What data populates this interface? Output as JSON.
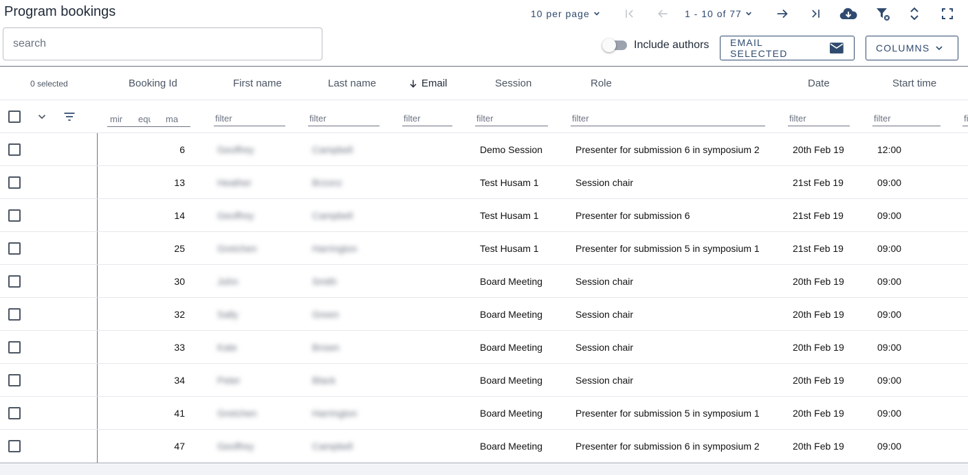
{
  "title": "Program bookings",
  "pager": {
    "per_page": "10 per page",
    "range": "1 - 10 of 77"
  },
  "search": {
    "placeholder": "search"
  },
  "toggle": {
    "label": "Include authors",
    "on": false
  },
  "buttons": {
    "email_selected": "EMAIL SELECTED",
    "columns": "COLUMNS"
  },
  "columns": {
    "selected": "0 selected",
    "booking_id": "Booking Id",
    "first_name": "First name",
    "last_name": "Last name",
    "email": "Email",
    "session": "Session",
    "role": "Role",
    "date": "Date",
    "start_time": "Start time"
  },
  "filters": {
    "min": "mir",
    "equ": "equ",
    "max": "ma",
    "filter": "filter"
  },
  "rows": [
    {
      "id": "6",
      "first": "Geoffrey",
      "last": "Campbell",
      "session": "Demo Session",
      "role": "Presenter for submission 6 in symposium 2",
      "date": "20th Feb 19",
      "time": "12:00"
    },
    {
      "id": "13",
      "first": "Heather",
      "last": "Brzonz",
      "session": "Test Husam 1",
      "role": "Session chair",
      "date": "21st Feb 19",
      "time": "09:00"
    },
    {
      "id": "14",
      "first": "Geoffrey",
      "last": "Campbell",
      "session": "Test Husam 1",
      "role": "Presenter for submission 6",
      "date": "21st Feb 19",
      "time": "09:00"
    },
    {
      "id": "25",
      "first": "Gretchen",
      "last": "Harrington",
      "session": "Test Husam 1",
      "role": "Presenter for submission 5 in symposium 1",
      "date": "21st Feb 19",
      "time": "09:00"
    },
    {
      "id": "30",
      "first": "John",
      "last": "Smith",
      "session": "Board Meeting",
      "role": "Session chair",
      "date": "20th Feb 19",
      "time": "09:00"
    },
    {
      "id": "32",
      "first": "Sally",
      "last": "Green",
      "session": "Board Meeting",
      "role": "Session chair",
      "date": "20th Feb 19",
      "time": "09:00"
    },
    {
      "id": "33",
      "first": "Kate",
      "last": "Brown",
      "session": "Board Meeting",
      "role": "Session chair",
      "date": "20th Feb 19",
      "time": "09:00"
    },
    {
      "id": "34",
      "first": "Peter",
      "last": "Black",
      "session": "Board Meeting",
      "role": "Session chair",
      "date": "20th Feb 19",
      "time": "09:00"
    },
    {
      "id": "41",
      "first": "Gretchen",
      "last": "Harrington",
      "session": "Board Meeting",
      "role": "Presenter for submission 5 in symposium 1",
      "date": "20th Feb 19",
      "time": "09:00"
    },
    {
      "id": "47",
      "first": "Geoffrey",
      "last": "Campbell",
      "session": "Board Meeting",
      "role": "Presenter for submission 6 in symposium 2",
      "date": "20th Feb 19",
      "time": "09:00"
    }
  ],
  "colors": {
    "accent": "#2f4a6e",
    "divider": "#e5e7eb"
  },
  "icons": [
    "chevron-down-icon",
    "first-page-icon",
    "arrow-left-icon",
    "arrow-right-icon",
    "last-page-icon",
    "cloud-download-icon",
    "filter-clear-icon",
    "expand-collapse-icon",
    "fullscreen-icon",
    "mail-icon",
    "arrow-down-icon",
    "filter-list-icon"
  ]
}
